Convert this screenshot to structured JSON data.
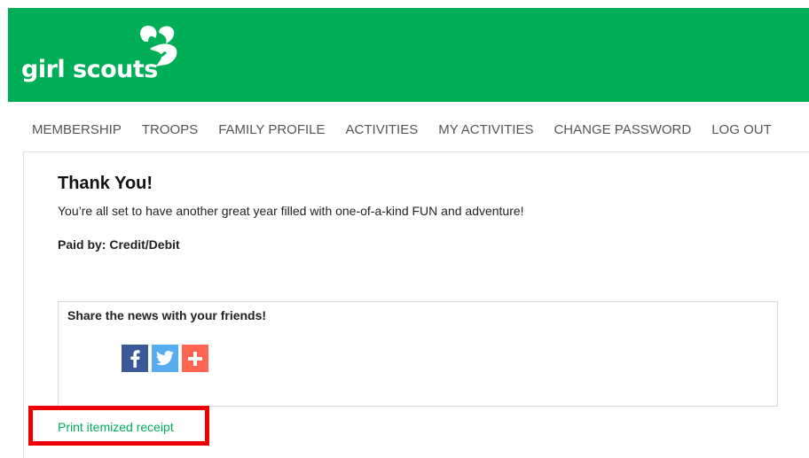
{
  "header": {
    "logo_text": "girl scouts",
    "brand_color": "#00ae58"
  },
  "nav": {
    "items": [
      {
        "label": "MEMBERSHIP"
      },
      {
        "label": "TROOPS"
      },
      {
        "label": "FAMILY PROFILE"
      },
      {
        "label": "ACTIVITIES"
      },
      {
        "label": "MY ACTIVITIES"
      },
      {
        "label": "CHANGE PASSWORD"
      },
      {
        "label": "LOG OUT"
      }
    ]
  },
  "main": {
    "title": "Thank You!",
    "message": "You’re all set to have another great year filled with one-of-a-kind FUN and adventure!",
    "paid_by": "Paid by: Credit/Debit",
    "share": {
      "title": "Share the news with your friends!",
      "buttons": [
        {
          "icon": "facebook-icon",
          "color": "#3b5998"
        },
        {
          "icon": "twitter-icon",
          "color": "#55acee"
        },
        {
          "icon": "plus-icon",
          "color": "#ff6550"
        }
      ]
    },
    "receipt_link": "Print itemized receipt",
    "highlight_color": "#ee0000"
  }
}
